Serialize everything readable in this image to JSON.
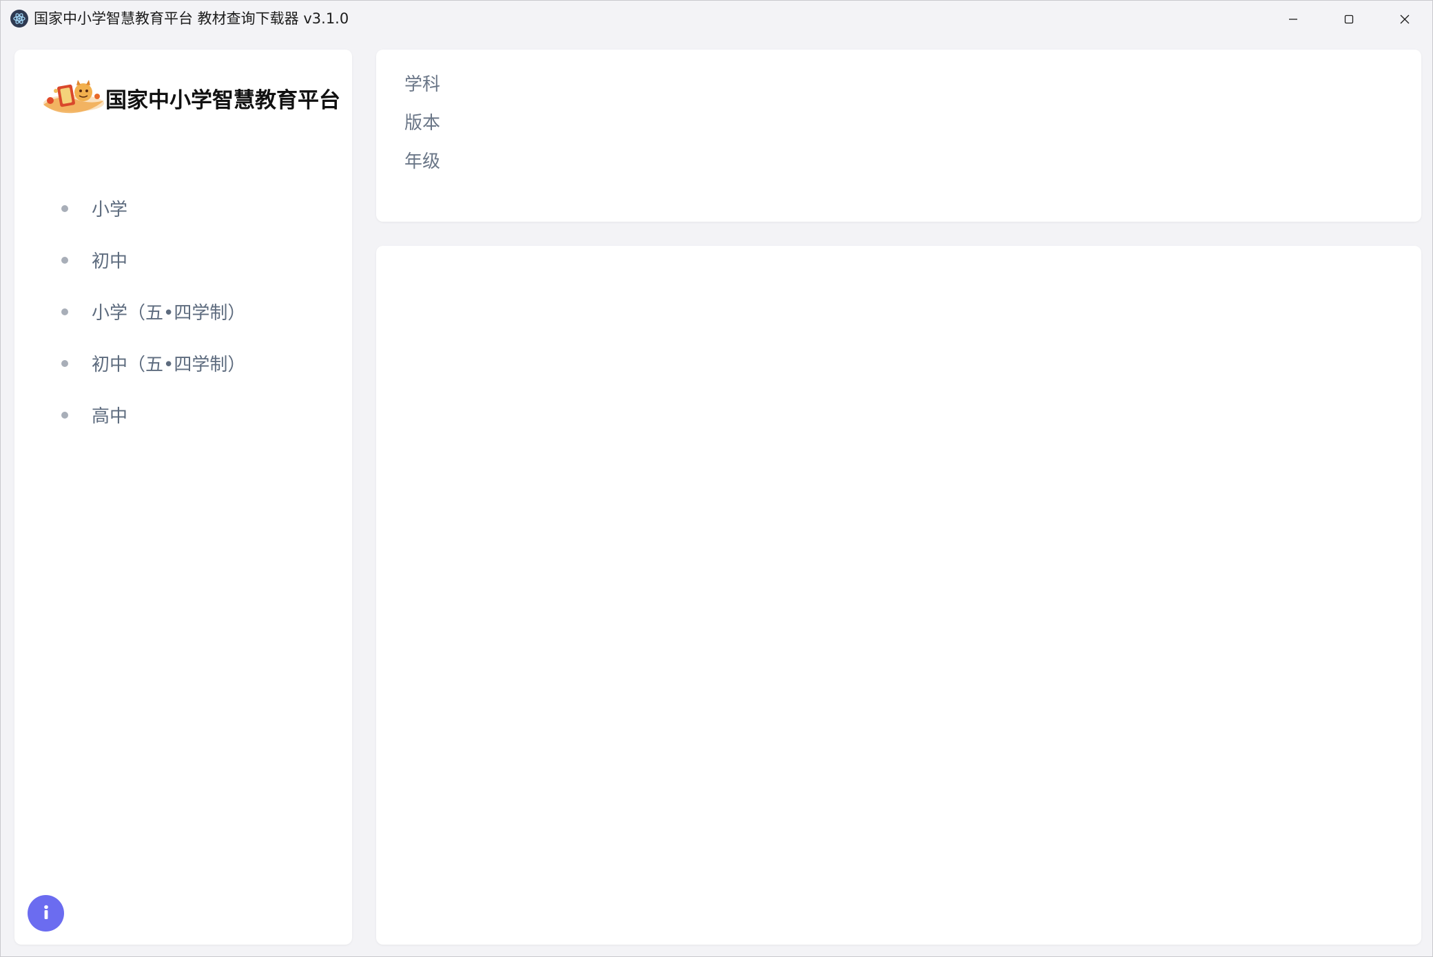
{
  "window": {
    "title": "国家中小学智慧教育平台 教材查询下载器 v3.1.0"
  },
  "titlebar": {
    "icons": {
      "app": "electron-app-icon",
      "minimize": "minimize-icon",
      "maximize": "maximize-icon",
      "close": "close-icon"
    }
  },
  "sidebar": {
    "logo_text": "国家中小学智慧教育平台",
    "items": [
      {
        "label": "小学"
      },
      {
        "label": "初中"
      },
      {
        "label": "小学（五•四学制）"
      },
      {
        "label": "初中（五•四学制）"
      },
      {
        "label": "高中"
      }
    ],
    "info_icon": "info-icon",
    "info_color": "#6b6cf0"
  },
  "filters": {
    "subject_label": "学科",
    "edition_label": "版本",
    "grade_label": "年级"
  },
  "colors": {
    "background": "#f3f3f6",
    "panel": "#ffffff",
    "nav_text": "#5d6b7e"
  }
}
